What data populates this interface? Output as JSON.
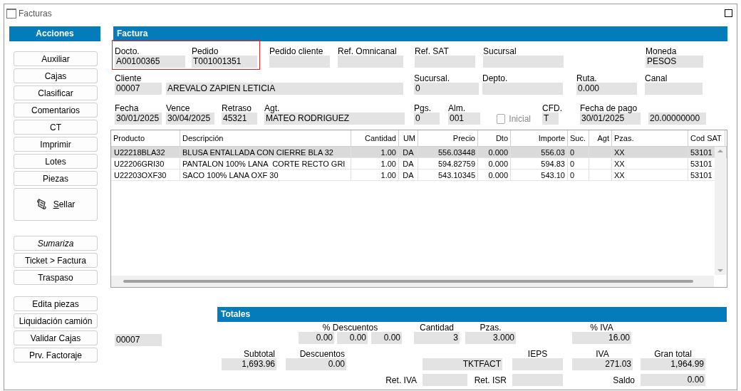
{
  "window": {
    "title": "Facturas"
  },
  "actions": {
    "title": "Acciones",
    "groups": [
      [
        {
          "label": "Auxiliar",
          "kind": "normal"
        },
        {
          "label": "Cajas",
          "kind": "normal"
        },
        {
          "label": "Clasificar",
          "kind": "normal"
        },
        {
          "label": "Comentarios",
          "kind": "normal"
        },
        {
          "label": "CT",
          "kind": "normal"
        },
        {
          "label": "Imprimir",
          "kind": "normal"
        },
        {
          "label": "Lotes",
          "kind": "normal"
        },
        {
          "label": "Piezas",
          "kind": "normal"
        },
        {
          "label": "Sellar",
          "kind": "large"
        }
      ],
      [
        {
          "label": "Sumariza",
          "kind": "italic"
        },
        {
          "label": "Ticket > Factura",
          "kind": "normal"
        },
        {
          "label": "Traspaso",
          "kind": "normal"
        }
      ],
      [
        {
          "label": "Edita piezas",
          "kind": "normal"
        },
        {
          "label": "Liquidación camión",
          "kind": "normal"
        },
        {
          "label": "Validar Cajas",
          "kind": "normal"
        },
        {
          "label": "Prv. Factoraje",
          "kind": "normal"
        }
      ]
    ]
  },
  "factura": {
    "title": "Factura",
    "rows": [
      {
        "fields": [
          {
            "label": "Docto.",
            "value": "A00100365",
            "highlighted": true
          },
          {
            "label": "Pedido",
            "value": "T001001351",
            "highlighted": true
          },
          {
            "label": "Pedido cliente",
            "highlighted": false
          },
          {
            "label": "Ref. Omnicanal",
            "highlighted": false
          },
          {
            "label": "Ref. SAT",
            "highlighted": false
          },
          {
            "label": "Sucursal",
            "highlighted": false
          },
          {
            "label": "Moneda",
            "value": "PESOS",
            "highlighted": false
          }
        ]
      },
      {
        "fields": [
          {
            "label": "Cliente",
            "value": "00007"
          },
          {
            "value": "AREVALO ZAPIEN LETICIA"
          },
          {
            "label": "Sucursal.",
            "value": "0"
          },
          {
            "label": "Depto."
          },
          {
            "label": "Ruta.",
            "value": "0.000"
          },
          {
            "label": "Canal"
          }
        ]
      },
      {
        "fields": [
          {
            "label": "Fecha",
            "value": "30/01/2025"
          },
          {
            "label": "Vence",
            "value": "30/04/2025"
          },
          {
            "label": "Retraso",
            "value": "45321"
          },
          {
            "label": "Agt.",
            "value": "MATEO RODRIGUEZ"
          },
          {
            "label": "Pgs.",
            "value": "0"
          },
          {
            "label": "Alm.",
            "value": "001"
          },
          {
            "kind": "checkbox",
            "label": "Inicial",
            "checked": false,
            "disabled": true
          },
          {
            "label": "CFD.",
            "value": "T"
          },
          {
            "label": "Fecha de pago",
            "value": "30/01/2025"
          },
          {
            "value": "20.00000000"
          }
        ]
      }
    ]
  },
  "table": {
    "columns": [
      "Producto",
      "Descripción",
      "Cantidad",
      "UM",
      "Precio",
      "Dto",
      "Importe",
      "Suc.",
      "Agt",
      "Pzas.",
      "Cod SAT"
    ],
    "rows": [
      {
        "selected": true,
        "cells": [
          "U22218BLA32",
          "BLUSA ENTALLADA CON CIERRE BLA 32",
          "1.00",
          "DA",
          "556.03448",
          "0.000",
          "556.03",
          "0",
          "",
          "XX",
          "53101"
        ]
      },
      {
        "selected": false,
        "cells": [
          "U22206GRI30",
          "PANTALON 100% LANA  CORTE RECTO GRI",
          "1.00",
          "DA",
          "594.82759",
          "0.000",
          "594.83",
          "0",
          "",
          "XX",
          "53101"
        ]
      },
      {
        "selected": false,
        "cells": [
          "U22203OXF30",
          "SACO 100% LANA OXF 30",
          "1.00",
          "DA",
          "543.10345",
          "0.000",
          "543.10",
          "0",
          "",
          "XX",
          "53101"
        ]
      }
    ]
  },
  "client_code": "00007",
  "totales": {
    "title": "Totales",
    "discounts": {
      "label": "% Descuentos",
      "values": [
        "0.00",
        "0.00",
        "0.00"
      ]
    },
    "row_a": [
      {
        "label": "Cantidad",
        "value": "3"
      },
      {
        "label": "Pzas.",
        "value": "3.000"
      },
      {
        "label": "% IVA",
        "value": "16.00"
      }
    ],
    "row_b": [
      {
        "label": "Subtotal",
        "value": "1,693.96"
      },
      {
        "label": "Descuentos",
        "value": "0.00"
      },
      {
        "value": "TKTFACT"
      },
      {
        "label": "IEPS"
      },
      {
        "label": "IVA",
        "value": "271.03"
      },
      {
        "label": "Gran total",
        "value": "1,964.99"
      }
    ],
    "row_c": [
      {
        "label": "Ret. IVA"
      },
      {
        "label": "Ret. ISR"
      },
      {
        "label": "Saldo",
        "value": "0.00"
      }
    ]
  }
}
